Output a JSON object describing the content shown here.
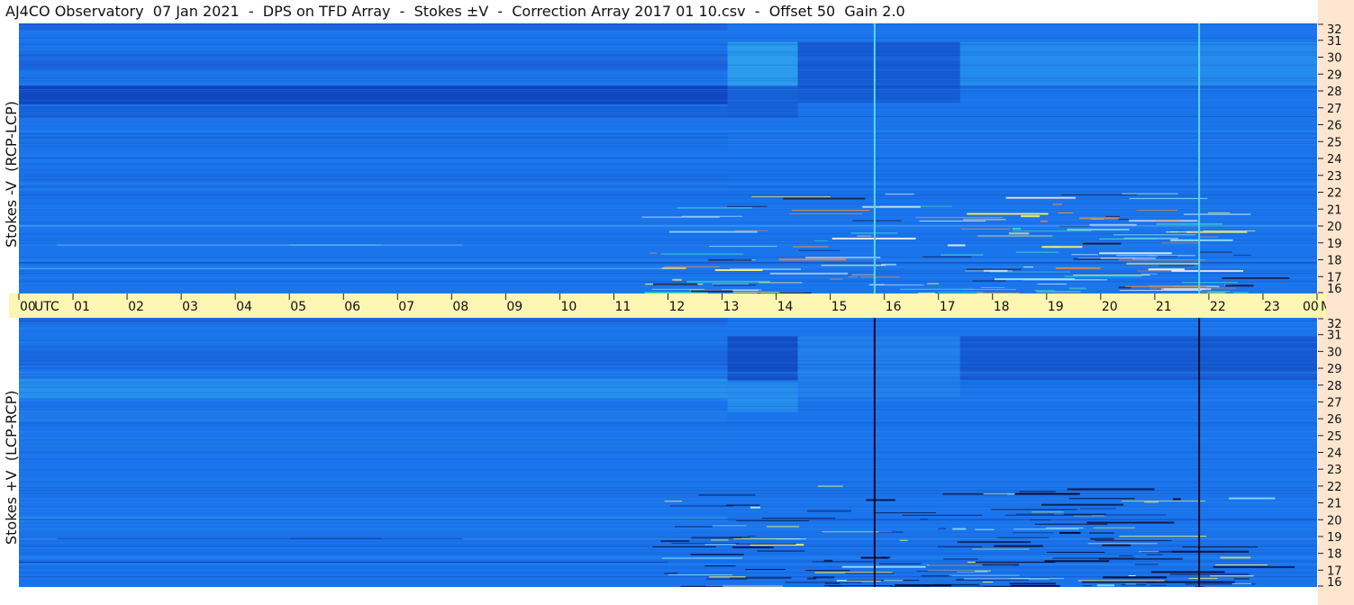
{
  "title": "AJ4CO Observatory  07 Jan 2021  -  DPS on TFD Array  -  Stokes ±V  -  Correction Array 2017 01 10.csv  -  Offset 50  Gain 2.0",
  "colors": {
    "background_blue": "#1a74ec",
    "time_axis_bg": "#fdf6b2",
    "freq_axis_bg": "#fde5cf"
  },
  "chart_data": {
    "type": "heatmap",
    "title": "AJ4CO Observatory  07 Jan 2021  -  DPS on TFD Array  -  Stokes ±V  -  Correction Array 2017 01 10.csv  -  Offset 50  Gain 2.0",
    "x_axis": {
      "unit_label": "UTC",
      "tick_labels": [
        "00",
        "01",
        "02",
        "03",
        "04",
        "05",
        "06",
        "07",
        "08",
        "09",
        "10",
        "11",
        "12",
        "13",
        "14",
        "15",
        "16",
        "17",
        "18",
        "19",
        "20",
        "21",
        "22",
        "23",
        "00"
      ],
      "range": [
        0,
        24
      ]
    },
    "y_axis": {
      "unit_label": "MHz",
      "tick_labels": [
        "32",
        "31",
        "30",
        "29",
        "28",
        "27",
        "26",
        "25",
        "24",
        "23",
        "22",
        "21",
        "20",
        "19",
        "18",
        "17",
        "16"
      ],
      "range": [
        16,
        32
      ]
    },
    "panels": [
      {
        "label": "Stokes -V  (RCP-LCP)",
        "vertical_lines_utc": [
          15.82,
          21.82
        ]
      },
      {
        "label": "Stokes +V  (LCP-RCP)",
        "vertical_lines_utc": [
          15.82,
          21.82
        ]
      }
    ]
  }
}
